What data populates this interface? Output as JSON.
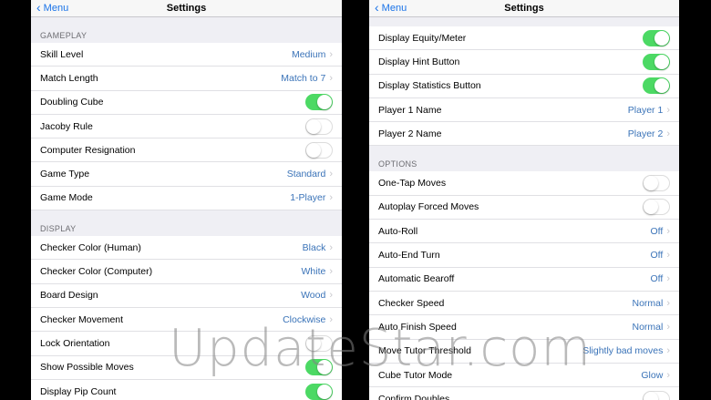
{
  "left": {
    "nav": {
      "back": "Menu",
      "title": "Settings"
    },
    "sections": [
      {
        "header": "GAMEPLAY",
        "rows": [
          {
            "label": "Skill Level",
            "value": "Medium",
            "type": "value"
          },
          {
            "label": "Match Length",
            "value": "Match to 7",
            "type": "value"
          },
          {
            "label": "Doubling Cube",
            "type": "toggle",
            "on": true
          },
          {
            "label": "Jacoby Rule",
            "type": "toggle",
            "on": false
          },
          {
            "label": "Computer Resignation",
            "type": "toggle",
            "on": false
          },
          {
            "label": "Game Type",
            "value": "Standard",
            "type": "value"
          },
          {
            "label": "Game Mode",
            "value": "1-Player",
            "type": "value"
          }
        ]
      },
      {
        "header": "DISPLAY",
        "rows": [
          {
            "label": "Checker Color (Human)",
            "value": "Black",
            "type": "value"
          },
          {
            "label": "Checker Color (Computer)",
            "value": "White",
            "type": "value"
          },
          {
            "label": "Board Design",
            "value": "Wood",
            "type": "value"
          },
          {
            "label": "Checker Movement",
            "value": "Clockwise",
            "type": "value"
          },
          {
            "label": "Lock Orientation",
            "type": "toggle",
            "on": false
          },
          {
            "label": "Show Possible Moves",
            "type": "toggle",
            "on": true
          },
          {
            "label": "Display Pip Count",
            "type": "toggle",
            "on": true
          }
        ]
      }
    ]
  },
  "right": {
    "nav": {
      "back": "Menu",
      "title": "Settings"
    },
    "top_rows": [
      {
        "label": "Display Equity/Meter",
        "type": "toggle",
        "on": true
      },
      {
        "label": "Display Hint Button",
        "type": "toggle",
        "on": true
      },
      {
        "label": "Display Statistics Button",
        "type": "toggle",
        "on": true
      },
      {
        "label": "Player 1 Name",
        "value": "Player 1",
        "type": "value"
      },
      {
        "label": "Player 2 Name",
        "value": "Player 2",
        "type": "value"
      }
    ],
    "sections": [
      {
        "header": "OPTIONS",
        "rows": [
          {
            "label": "One-Tap Moves",
            "type": "toggle",
            "on": false
          },
          {
            "label": "Autoplay Forced Moves",
            "type": "toggle",
            "on": false
          },
          {
            "label": "Auto-Roll",
            "value": "Off",
            "type": "value"
          },
          {
            "label": "Auto-End Turn",
            "value": "Off",
            "type": "value"
          },
          {
            "label": "Automatic Bearoff",
            "value": "Off",
            "type": "value"
          },
          {
            "label": "Checker Speed",
            "value": "Normal",
            "type": "value"
          },
          {
            "label": "Auto Finish Speed",
            "value": "Normal",
            "type": "value"
          },
          {
            "label": "Move Tutor Threshold",
            "value": "Slightly bad moves",
            "type": "value"
          },
          {
            "label": "Cube Tutor Mode",
            "value": "Glow",
            "type": "value"
          },
          {
            "label": "Confirm Doubles",
            "type": "toggle",
            "on": false
          }
        ]
      }
    ]
  },
  "watermark": "UpdateStar.com"
}
